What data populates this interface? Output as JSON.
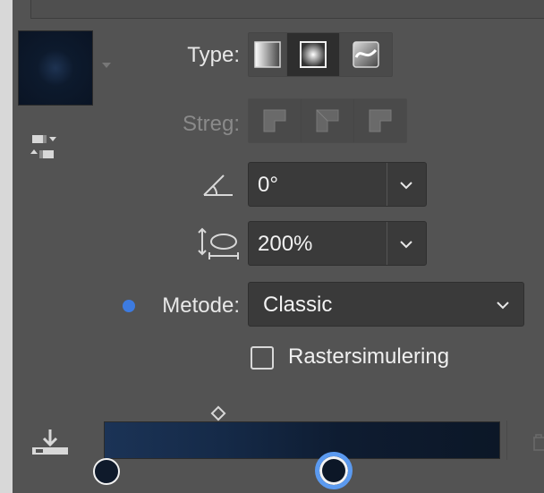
{
  "swatch": {
    "colors": [
      "#1e3352",
      "#0a1424"
    ]
  },
  "type_row": {
    "label": "Type:",
    "buttons": [
      {
        "name": "linear-gradient-icon",
        "active": false
      },
      {
        "name": "radial-gradient-icon",
        "active": true
      },
      {
        "name": "freeform-gradient-icon",
        "active": false
      }
    ]
  },
  "stroke_row": {
    "label": "Streg:",
    "buttons": [
      "stroke-within-icon",
      "stroke-along-icon",
      "stroke-across-icon"
    ]
  },
  "angle": {
    "value": "0°",
    "icon": "angle-icon"
  },
  "aspect": {
    "value": "200%",
    "icon": "aspect-ratio-icon"
  },
  "method": {
    "label": "Metode:",
    "value": "Classic",
    "accent": "#3d7be0"
  },
  "raster": {
    "label": "Rastersimulering",
    "checked": false
  },
  "gradient_slider": {
    "start_color": "#1b3356",
    "end_color": "#0c1727",
    "selected_stop_ring": "#5b9af0"
  }
}
